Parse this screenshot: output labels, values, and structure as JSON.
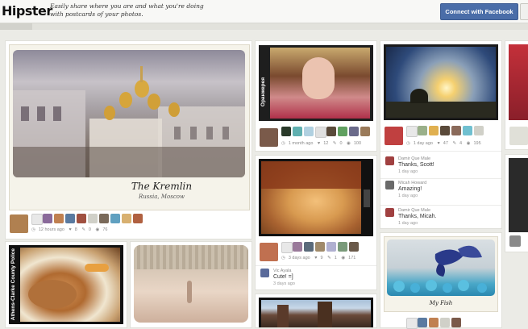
{
  "header": {
    "logo": "Hipster",
    "tagline": "Easily share where you are and what you're doing with postcards of your photos.",
    "fb_button": "Connect with Facebook"
  },
  "cards": {
    "kremlin": {
      "title": "The Kremlin",
      "location": "Russia, Moscow",
      "time": "12 hours ago",
      "likes": "8",
      "comments": "0",
      "views": "76"
    },
    "girl": {
      "vertical_text": "Оранжерея",
      "time": "1 month ago",
      "likes": "12",
      "comments": "0",
      "views": "100"
    },
    "sunset": {
      "time": "1 day ago",
      "likes": "47",
      "comments": "4",
      "views": "195"
    },
    "selfie": {
      "time": "3 days ago",
      "likes": "9",
      "comments": "1",
      "views": "171"
    },
    "police": {
      "vertical_text": "Athens-Clarke County Police"
    },
    "fish": {
      "title": "My Fish"
    }
  },
  "comments_sunset": [
    {
      "name": "Damir Que Male",
      "text": "Thanks, Scott!",
      "time": "1 day ago"
    },
    {
      "name": "Micah Howard",
      "text": "Amazing!",
      "time": "1 day ago"
    },
    {
      "name": "Damir Que Male",
      "text": "Thanks, Micah.",
      "time": "1 day ago"
    }
  ],
  "comment_selfie": {
    "name": "Vic Ayala",
    "text": "Cute! =]",
    "time": "3 days ago"
  },
  "icons": {
    "time": "clock-icon",
    "likes": "heart-icon",
    "comments": "comment-icon",
    "views": "eye-icon"
  },
  "colors": {
    "facebook": "#4a6da8",
    "background": "#ebebe6"
  }
}
